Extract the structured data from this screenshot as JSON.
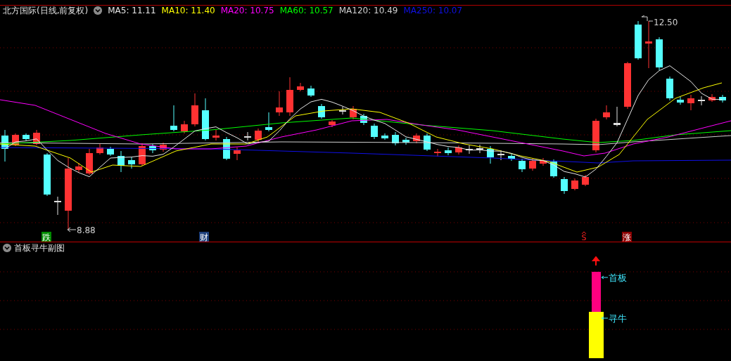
{
  "header": {
    "title": "北方国际(日线,前复权)",
    "ma_legend": [
      {
        "label": "MA5: 11.11",
        "color": "#e6e6e6"
      },
      {
        "label": "MA10: 11.40",
        "color": "#ffff00"
      },
      {
        "label": "MA20: 10.75",
        "color": "#ff00ff"
      },
      {
        "label": "MA60: 10.57",
        "color": "#00ff00"
      },
      {
        "label": "MA120: 10.49",
        "color": "#d0d0d0"
      },
      {
        "label": "MA250: 10.07",
        "color": "#1010e8"
      }
    ]
  },
  "price_labels": [
    {
      "kind": "high",
      "text": "12.50"
    },
    {
      "kind": "low",
      "text": "8.88"
    }
  ],
  "signals": [
    {
      "text": "跌",
      "color": "#008a00"
    },
    {
      "text": "财",
      "color": "#1e3f7a"
    },
    {
      "text": "S",
      "color": "#000000"
    },
    {
      "text": "涨",
      "color": "#8a0000"
    }
  ],
  "sub_panel": {
    "title": "首板寻牛副图",
    "labels": [
      {
        "text": "首板"
      },
      {
        "text": "寻牛"
      }
    ]
  }
}
